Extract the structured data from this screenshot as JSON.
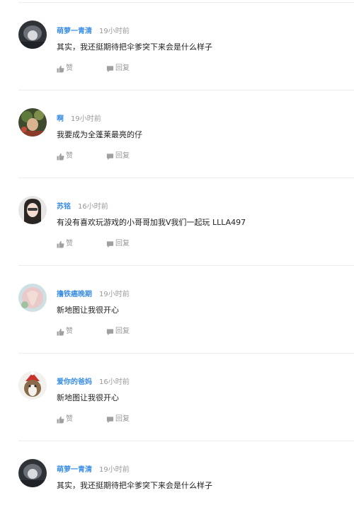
{
  "actions": {
    "like_label": "赞",
    "reply_label": "回复"
  },
  "comments": [
    {
      "username": "萌萝一青清",
      "time": "19小时前",
      "text": "其实，我还挺期待把伞爹突下来会是什么样子"
    },
    {
      "username": "啊",
      "time": "19小时前",
      "text": "我要成为全蓬莱最亮的仔"
    },
    {
      "username": "苏铭",
      "time": "16小时前",
      "text": "有没有喜欢玩游戏的小哥哥加我V我们一起玩 LLLA497"
    },
    {
      "username": "撸铁癌晚期",
      "time": "19小时前",
      "text": "新地图让我很开心"
    },
    {
      "username": "爱你的爸妈",
      "time": "16小时前",
      "text": "新地图让我很开心"
    },
    {
      "username": "萌萝一青清",
      "time": "19小时前",
      "text": "其实，我还挺期待把伞爹突下来会是什么样子"
    }
  ]
}
